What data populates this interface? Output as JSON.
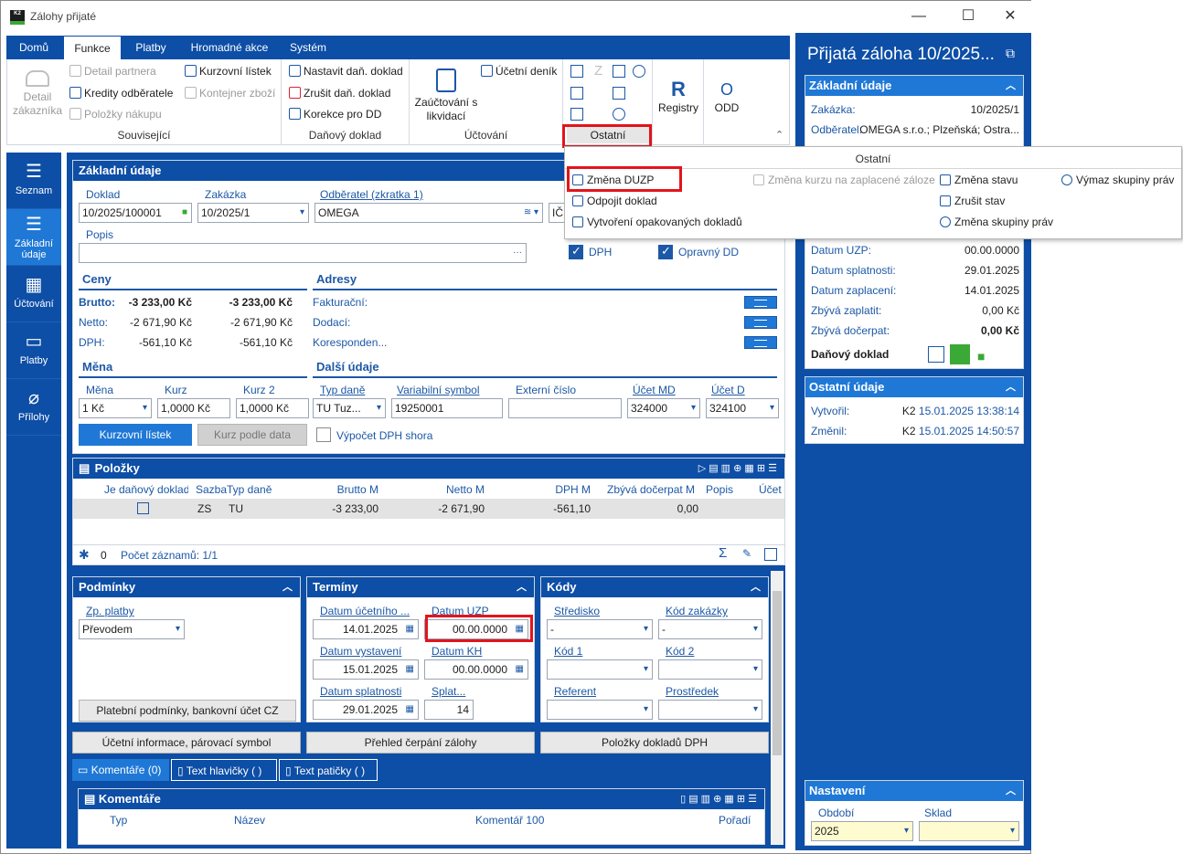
{
  "window": {
    "title": "Zálohy přijaté",
    "min": "—",
    "max": "☐",
    "close": "✕"
  },
  "tabs": [
    "Domů",
    "Funkce",
    "Platby",
    "Hromadné akce",
    "Systém"
  ],
  "ribbon": {
    "souvisejici": {
      "label": "Související",
      "detail_zakaznika": "Detail zákazníka",
      "detail_partnera": "Detail partnera",
      "kredity": "Kredity odběratele",
      "polozky_nakupu": "Položky nákupu",
      "kurzovni_listek": "Kurzovní lístek",
      "kontejner_zbozi": "Kontejner zboží"
    },
    "danovy": {
      "label": "Daňový doklad",
      "nastavit": "Nastavit daň. doklad",
      "zrusit": "Zrušit daň. doklad",
      "korekce": "Korekce pro DD"
    },
    "uctovani": {
      "label": "Účtování",
      "zauctovani": "Zaúčtování s likvidací",
      "ucetni_denik": "Účetní deník"
    },
    "ostatni_label": "Ostatní",
    "registry": "Registry",
    "odd": "ODD"
  },
  "sidenav": [
    "Seznam",
    "Základní údaje",
    "Účtování",
    "Platby",
    "Přílohy"
  ],
  "zakladni": {
    "title": "Základní údaje",
    "doklad_l": "Doklad",
    "doklad": "10/2025/100001",
    "zakazka_l": "Zakázka",
    "zakazka": "10/2025/1",
    "odberatel_l": "Odběratel (zkratka 1)",
    "odberatel": "OMEGA",
    "ic_cut": "IČ",
    "popis_l": "Popis",
    "popis_btn": "···",
    "dph_l": "DPH",
    "opravny_l": "Opravný DD"
  },
  "ceny": {
    "title": "Ceny",
    "rows": [
      {
        "l": "Brutto:",
        "a": "-3 233,00 Kč",
        "b": "-3 233,00 Kč"
      },
      {
        "l": "Netto:",
        "a": "-2 671,90 Kč",
        "b": "-2 671,90 Kč"
      },
      {
        "l": "DPH:",
        "a": "-561,10 Kč",
        "b": "-561,10 Kč"
      }
    ]
  },
  "adresy": {
    "title": "Adresy",
    "rows": [
      "Fakturační:",
      "Dodací:",
      "Koresponden..."
    ]
  },
  "mena": {
    "title": "Měna",
    "mena_l": "Měna",
    "mena": "1 Kč",
    "kurz_l": "Kurz",
    "kurz": "1,0000 Kč",
    "kurz2_l": "Kurz 2",
    "kurz2": "1,0000 Kč",
    "btn_kurzovni": "Kurzovní lístek",
    "btn_kurz_data": "Kurz podle data"
  },
  "dalsi": {
    "title": "Další údaje",
    "typdane_l": "Typ daně",
    "typdane": "TU Tuz...",
    "vs_l": "Variabilní symbol",
    "vs": "19250001",
    "ext_l": "Externí číslo",
    "ext": "",
    "md_l": "Účet MD",
    "md": "324000",
    "d_l": "Účet D",
    "d": "324100",
    "vypocet": "Výpočet DPH shora"
  },
  "polozky": {
    "title": "Položky",
    "cols": [
      "Je daňový doklad",
      "Sazba",
      "Typ daně",
      "Brutto M",
      "Netto M",
      "DPH M",
      "Zbývá dočerpat M",
      "Popis",
      "Účet"
    ],
    "row": {
      "sazba": "ZS",
      "typ": "TU",
      "brutto": "-3 233,00",
      "netto": "-2 671,90",
      "dph": "-561,10",
      "zbyva": "0,00"
    },
    "count_n": "0",
    "count": "Počet záznamů: 1/1"
  },
  "podminky": {
    "title": "Podmínky",
    "zp_l": "Zp. platby",
    "zp": "Převodem",
    "btn": "Platební podmínky, bankovní účet CZ"
  },
  "terminy": {
    "title": "Termíny",
    "ucet_l": "Datum účetního ...",
    "ucet": "14.01.2025",
    "uzp_l": "Datum UZP",
    "uzp": "00.00.0000",
    "vyst_l": "Datum vystavení",
    "vyst": "15.01.2025",
    "kh_l": "Datum KH",
    "kh": "00.00.0000",
    "splat_l": "Datum splatnosti",
    "splat": "29.01.2025",
    "splatd_l": "Splat...",
    "splatd": "14"
  },
  "kody": {
    "title": "Kódy",
    "stredisko_l": "Středisko",
    "stredisko": "-",
    "kodzak_l": "Kód zakázky",
    "kodzak": "-",
    "kod1_l": "Kód 1",
    "kod1": "",
    "kod2_l": "Kód 2",
    "kod2": "",
    "referent_l": "Referent",
    "referent": "",
    "prostredek_l": "Prostředek",
    "prostredek": ""
  },
  "bottom_buttons": [
    "Účetní informace, párovací symbol",
    "Přehled čerpání zálohy",
    "Položky dokladů DPH"
  ],
  "subtabs": [
    "Komentáře (0)",
    "Text hlavičky ( )",
    "Text patičky ( )"
  ],
  "komentare": {
    "title": "Komentáře",
    "cols": [
      "Typ",
      "Název",
      "Komentář 100",
      "Pořadí"
    ]
  },
  "rpanel": {
    "title": "Přijatá záloha 10/2025...",
    "zakladni_title": "Základní údaje",
    "zakazka_k": "Zakázka:",
    "zakazka_v": "10/2025/1",
    "odberatel_k": "Odběratel:",
    "odberatel_v": "OMEGA s.r.o.; Plzeňská; Ostra...",
    "rows": [
      {
        "k": "Datum UZP:",
        "v": "00.00.0000"
      },
      {
        "k": "Datum splatnosti:",
        "v": "29.01.2025"
      },
      {
        "k": "Datum zaplacení:",
        "v": "14.01.2025"
      },
      {
        "k": "Zbývá zaplatit:",
        "v": "0,00 Kč"
      },
      {
        "k": "Zbývá dočerpat:",
        "v": "0,00 Kč"
      }
    ],
    "danovy": "Daňový doklad",
    "ostatni_title": "Ostatní údaje",
    "vytvoril_k": "Vytvořil:",
    "vytvoril_u": "K2",
    "vytvoril_d": "15.01.2025 13:38:14",
    "zmenil_k": "Změnil:",
    "zmenil_u": "K2",
    "zmenil_d": "15.01.2025 14:50:57",
    "nastaveni_title": "Nastavení",
    "obdobi_l": "Období",
    "obdobi": "2025",
    "sklad_l": "Sklad",
    "sklad": ""
  },
  "menu": {
    "title": "Ostatní",
    "zmena_duzp": "Změna DUZP",
    "odpojit": "Odpojit doklad",
    "vytvoreni": "Vytvoření opakovaných dokladů",
    "zmena_kurzu": "Změna kurzu na zaplacené záloze",
    "zmena_stavu": "Změna stavu",
    "zrusit_stav": "Zrušit stav",
    "zmena_skupiny": "Změna skupiny práv",
    "vymaz": "Výmaz skupiny práv"
  },
  "colors": {
    "accent": "#0d4ea6",
    "light_accent": "#1f78d6",
    "highlight": "#e3141c",
    "green": "#3aa935"
  }
}
